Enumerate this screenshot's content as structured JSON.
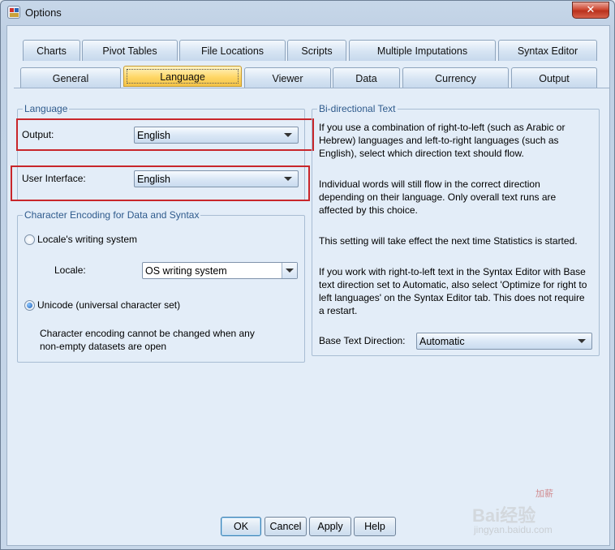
{
  "window": {
    "title": "Options",
    "close_label": "✕"
  },
  "tabs_row1": [
    "Charts",
    "Pivot Tables",
    "File Locations",
    "Scripts",
    "Multiple Imputations",
    "Syntax Editor"
  ],
  "tabs_row2": [
    "General",
    "Language",
    "Viewer",
    "Data",
    "Currency",
    "Output"
  ],
  "active_tab": "Language",
  "language_group": {
    "legend": "Language",
    "output_label": "Output:",
    "output_value": "English",
    "ui_label": "User Interface:",
    "ui_value": "English"
  },
  "encoding_group": {
    "legend": "Character Encoding for Data and Syntax",
    "locale_radio": "Locale's writing system",
    "locale_label": "Locale:",
    "locale_value": "OS writing system",
    "unicode_radio": "Unicode (universal character set)",
    "note_line1": "Character encoding cannot be changed when any",
    "note_line2": "non-empty datasets are open"
  },
  "bidi_group": {
    "legend": "Bi-directional Text",
    "p1": [
      "If you use a combination of right-to-left (such as Arabic or",
      "Hebrew) languages and left-to-right languages (such as",
      "English), select which direction text should flow."
    ],
    "p2": [
      "Individual words will still flow in the correct direction",
      "depending on their language. Only overall text runs are",
      "affected by this choice."
    ],
    "p3": [
      "This setting will take effect the next time Statistics is started."
    ],
    "p4": [
      "If you work with right-to-left text in the Syntax Editor with Base",
      "text direction set to Automatic, also select 'Optimize for right to",
      "left languages' on the Syntax Editor tab. This does not require",
      "a restart."
    ],
    "base_dir_label": "Base Text Direction:",
    "base_dir_value": "Automatic"
  },
  "buttons": {
    "ok": "OK",
    "cancel": "Cancel",
    "apply": "Apply",
    "help": "Help"
  },
  "watermark": {
    "text": "Bai经验",
    "url": "jingyan.baidu.com",
    "small": "加薪"
  },
  "colors": {
    "highlight": "#c8262b",
    "active_tab": "#ffd766",
    "legend_text": "#2e5a8c"
  }
}
